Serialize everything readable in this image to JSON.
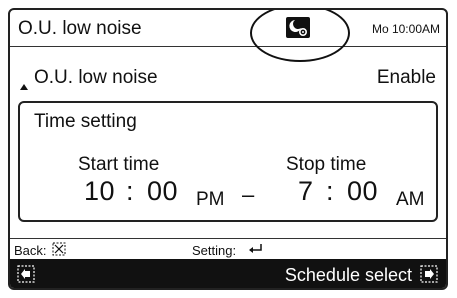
{
  "header": {
    "title": "O.U. low noise",
    "clock": "Mo 10:00AM",
    "status_icon": "night-mode-icon"
  },
  "setting": {
    "name": "O.U. low noise",
    "value": "Enable"
  },
  "time_panel": {
    "title": "Time setting",
    "start_label": "Start time",
    "start_hour": "10",
    "start_sep": ":",
    "start_minute": "00",
    "start_period": "PM",
    "dash": "–",
    "stop_label": "Stop time",
    "stop_hour": "7",
    "stop_sep": ":",
    "stop_minute": "00",
    "stop_period": "AM"
  },
  "hints": {
    "back": "Back:",
    "back_icon": "cancel-box-icon",
    "setting": "Setting:",
    "setting_icon": "enter-arrow-icon"
  },
  "footer": {
    "left_icon": "back-box-icon",
    "label": "Schedule select",
    "right_icon": "forward-box-icon"
  }
}
